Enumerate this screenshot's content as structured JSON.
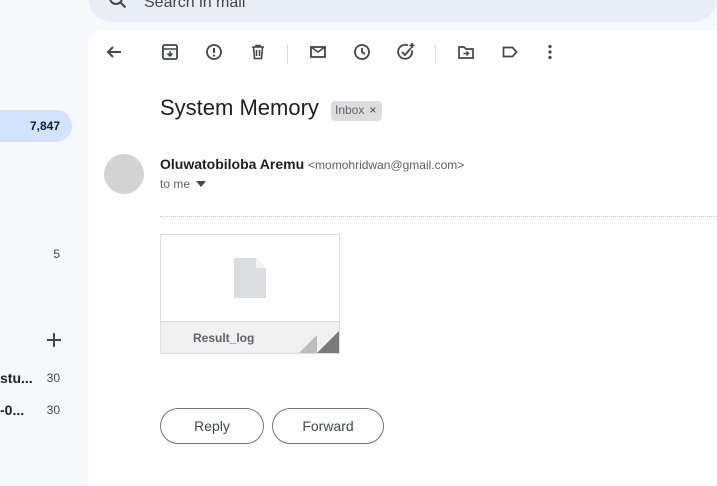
{
  "search": {
    "placeholder": "Search in mail"
  },
  "sidebar": {
    "counts": {
      "inbox": "7,847",
      "drafts": "5",
      "label_a": "30",
      "label_b": "30"
    },
    "labels": {
      "label_a": "stu...",
      "label_b": "-0..."
    }
  },
  "toolbar": {
    "icons": [
      "back-icon",
      "archive-icon",
      "report-spam-icon",
      "delete-icon",
      "mark-unread-icon",
      "snooze-icon",
      "add-task-icon",
      "move-to-icon",
      "label-icon",
      "more-icon"
    ]
  },
  "message": {
    "subject": "System Memory",
    "label_chip": "Inbox",
    "chip_close": "×",
    "sender_name": "Oluwatobiloba Aremu",
    "sender_email": "<momohridwan@gmail.com>",
    "recipient": "to me"
  },
  "attachment": {
    "name": "Result_log"
  },
  "actions": {
    "reply": "Reply",
    "forward": "Forward"
  },
  "colors": {
    "accent_bg": "#d3e3fd",
    "panel": "#ffffff",
    "page_bg": "#f6f8fc"
  }
}
